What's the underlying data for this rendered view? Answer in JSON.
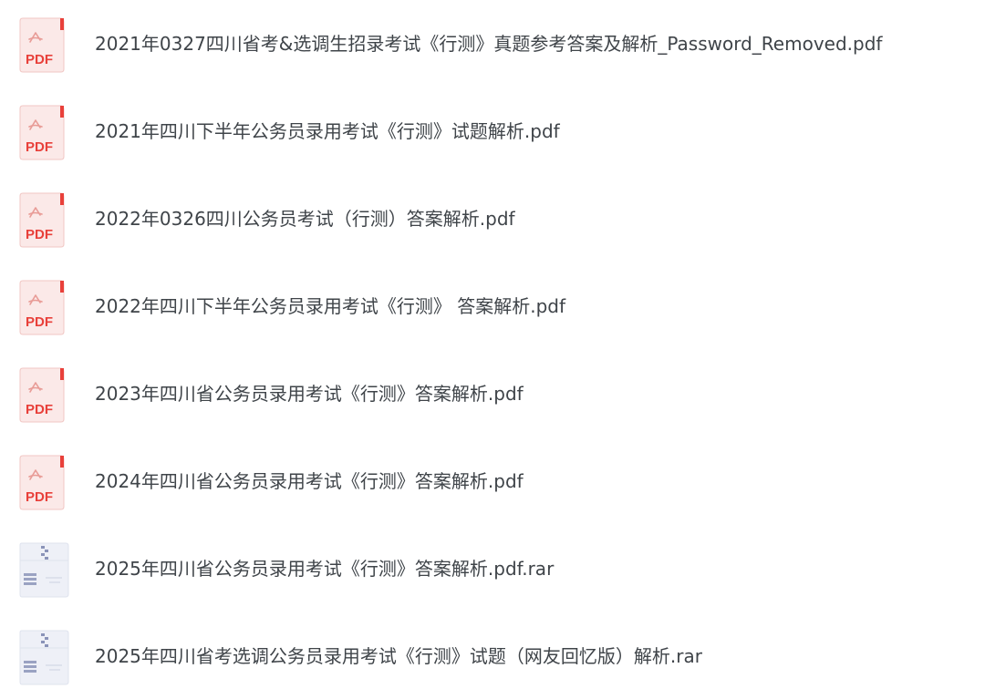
{
  "files": [
    {
      "name": "2021年0327四川省考&选调生招录考试《行测》真题参考答案及解析_Password_Removed.pdf",
      "type": "pdf",
      "icon": "pdf-file-icon",
      "icon_label": "PDF"
    },
    {
      "name": "2021年四川下半年公务员录用考试《行测》试题解析.pdf",
      "type": "pdf",
      "icon": "pdf-file-icon",
      "icon_label": "PDF"
    },
    {
      "name": "2022年0326四川公务员考试（行测）答案解析.pdf",
      "type": "pdf",
      "icon": "pdf-file-icon",
      "icon_label": "PDF"
    },
    {
      "name": "2022年四川下半年公务员录用考试《行测》 答案解析.pdf",
      "type": "pdf",
      "icon": "pdf-file-icon",
      "icon_label": "PDF"
    },
    {
      "name": "2023年四川省公务员录用考试《行测》答案解析.pdf",
      "type": "pdf",
      "icon": "pdf-file-icon",
      "icon_label": "PDF"
    },
    {
      "name": "2024年四川省公务员录用考试《行测》答案解析.pdf",
      "type": "pdf",
      "icon": "pdf-file-icon",
      "icon_label": "PDF"
    },
    {
      "name": "2025年四川省公务员录用考试《行测》答案解析.pdf.rar",
      "type": "rar",
      "icon": "archive-file-icon"
    },
    {
      "name": "2025年四川省考选调公务员录用考试《行测》试题（网友回忆版）解析.rar",
      "type": "rar",
      "icon": "archive-file-icon"
    }
  ],
  "colors": {
    "pdf_accent": "#e8403a",
    "pdf_tint": "#fbe9e8",
    "archive_tint": "#e9ecf5",
    "archive_accent": "#8a93b8",
    "text": "#3f4449"
  }
}
